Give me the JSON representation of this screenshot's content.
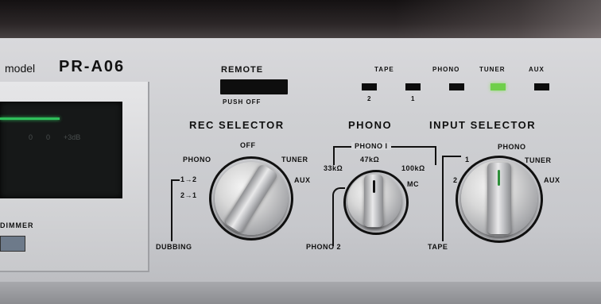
{
  "model": {
    "prefix": "model",
    "name": "PR-A06"
  },
  "meter": {
    "ticks": [
      "0",
      "0",
      "+3dB"
    ],
    "dimmer_label": "DIMMER"
  },
  "remote": {
    "title": "REMOTE",
    "sub": "PUSH OFF"
  },
  "indicators": {
    "tape_label": "TAPE",
    "tape_nums": [
      "2",
      "1"
    ],
    "labels": [
      "PHONO",
      "TUNER",
      "AUX"
    ],
    "active": "TUNER",
    "active_color": "#6fcf4a"
  },
  "rec_selector": {
    "title": "REC SELECTOR",
    "positions": [
      "OFF",
      "PHONO",
      "TUNER",
      "AUX",
      "1→2",
      "2→1"
    ],
    "dubbing": "DUBBING"
  },
  "phono": {
    "title": "PHONO",
    "phono1": "PHONO I",
    "loads": [
      "33kΩ",
      "47kΩ",
      "100kΩ"
    ],
    "mc": "MC",
    "phono2": "PHONO 2"
  },
  "input_selector": {
    "title": "INPUT SELECTOR",
    "positions": [
      "PHONO",
      "TUNER",
      "AUX",
      "1",
      "2"
    ],
    "tape": "TAPE"
  }
}
